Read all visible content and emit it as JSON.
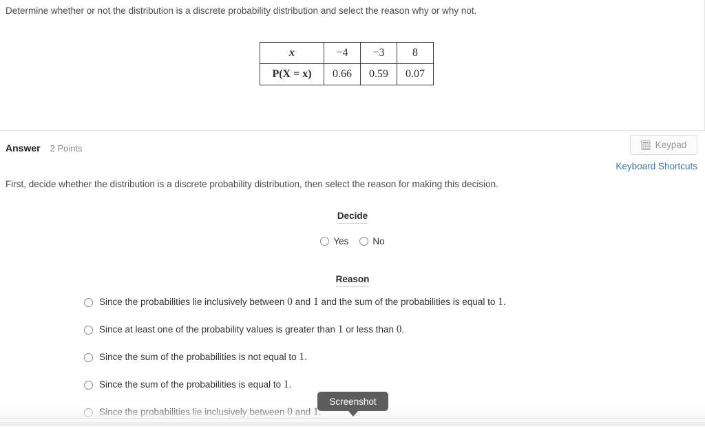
{
  "question": {
    "prompt": "Determine whether or not the distribution is a discrete probability distribution and select the reason why or why not.",
    "table": {
      "row_labels": [
        "x",
        "P(X  =  x)"
      ],
      "x_values": [
        "−4",
        "−3",
        "8"
      ],
      "p_values": [
        "0.66",
        "0.59",
        "0.07"
      ]
    }
  },
  "answer": {
    "label": "Answer",
    "points": "2 Points",
    "instruction": "First, decide whether the distribution is a discrete probability distribution, then select the reason for making this decision.",
    "keypad_button": {
      "label": "Keypad",
      "icon": "calculator-icon"
    },
    "keyboard_shortcuts_link": "Keyboard Shortcuts",
    "decide": {
      "heading": "Decide",
      "options": [
        {
          "label": "Yes",
          "selected": false
        },
        {
          "label": "No",
          "selected": false
        }
      ]
    },
    "reason": {
      "heading": "Reason",
      "options": [
        {
          "parts": [
            "Since the probabilities lie inclusively between ",
            "0",
            " and ",
            "1",
            " and the sum of the probabilities is equal to ",
            "1",
            "."
          ],
          "selected": false
        },
        {
          "parts": [
            "Since at least one of the probability values is greater than ",
            "1",
            " or less than ",
            "0",
            "."
          ],
          "selected": false
        },
        {
          "parts": [
            "Since the sum of the probabilities is not equal to ",
            "1",
            "."
          ],
          "selected": false
        },
        {
          "parts": [
            "Since the sum of the probabilities is equal to ",
            "1",
            "."
          ],
          "selected": false
        },
        {
          "parts": [
            "Since the probabilities lie inclusively between ",
            "0",
            " and ",
            "1",
            "."
          ],
          "selected": false
        }
      ]
    }
  },
  "tooltip": {
    "label": "Screenshot"
  },
  "colors": {
    "link": "#3a76ab",
    "tooltip_bg": "#5d5d5d",
    "text": "#333333",
    "muted": "#8a8a8a",
    "table_border": "#3a3a3a"
  }
}
